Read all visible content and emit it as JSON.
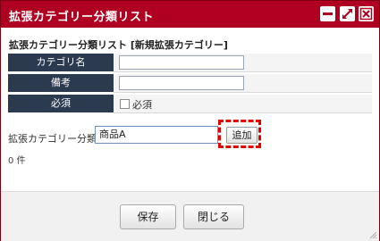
{
  "window": {
    "title": "拡張カテゴリー分類リスト"
  },
  "section_title": "拡張カテゴリー分類リスト [新規拡張カテゴリー]",
  "form": {
    "rows": [
      {
        "label": "カテゴリ名",
        "value": ""
      },
      {
        "label": "備考",
        "value": ""
      },
      {
        "label": "必須",
        "checkbox_label": "必須",
        "checked": false
      }
    ]
  },
  "category": {
    "label": "拡張カテゴリー分類",
    "value": "商品A",
    "add_label": "追加"
  },
  "count_text": "0 件",
  "footer": {
    "save_label": "保存",
    "close_label": "閉じる"
  },
  "colors": {
    "titlebar": "#b00021",
    "label_bg": "#2b3a4f",
    "highlight": "#e00000"
  }
}
